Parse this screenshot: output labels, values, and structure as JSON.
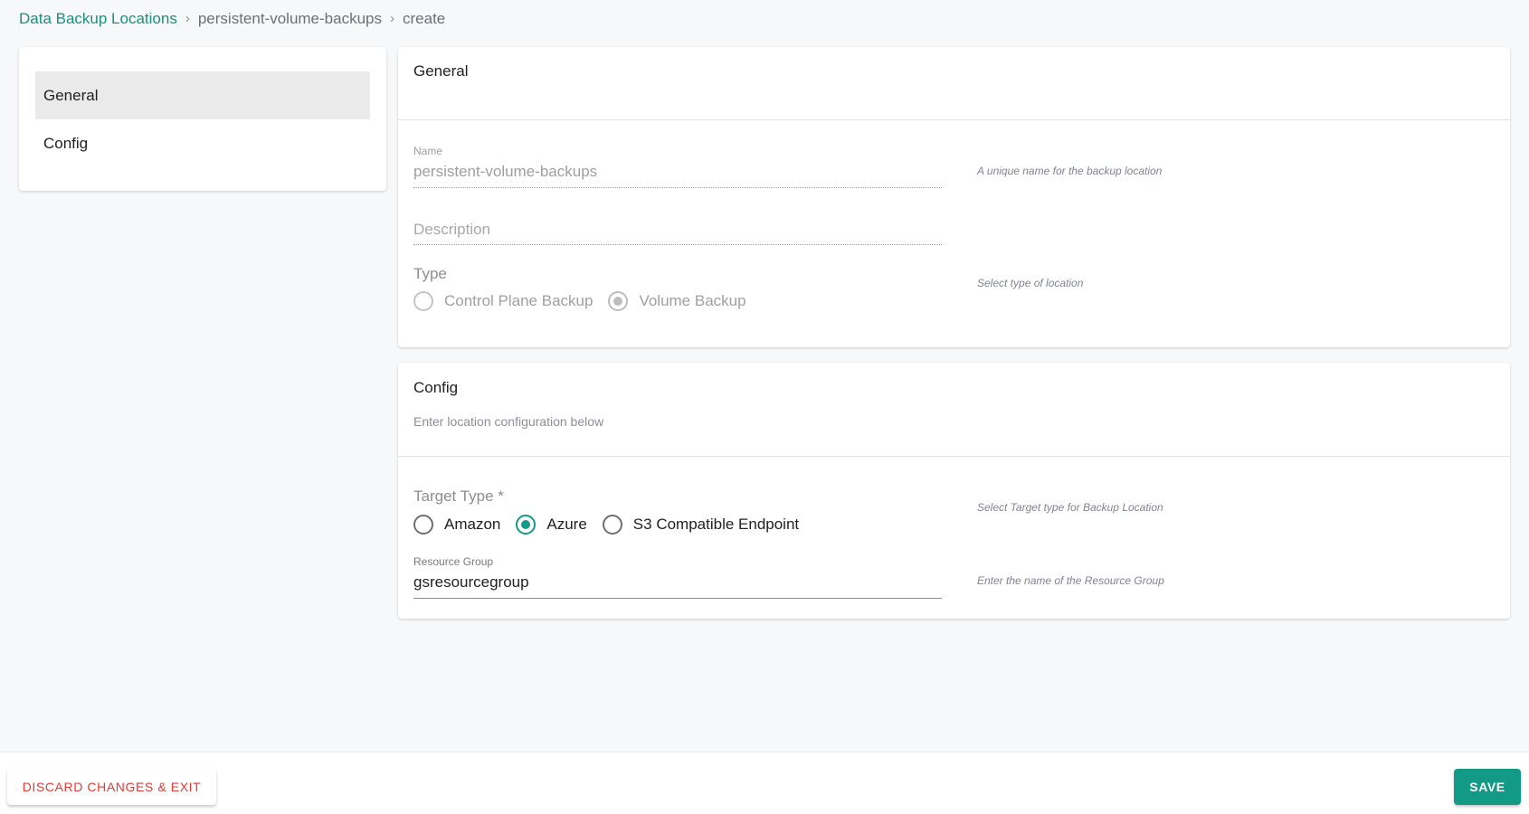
{
  "breadcrumb": {
    "items": [
      {
        "label": "Data Backup Locations",
        "link": true
      },
      {
        "label": "persistent-volume-backups",
        "link": false
      },
      {
        "label": "create",
        "link": false
      }
    ],
    "separator": "›"
  },
  "sidebar": {
    "items": [
      {
        "label": "General",
        "active": true
      },
      {
        "label": "Config",
        "active": false
      }
    ]
  },
  "general": {
    "title": "General",
    "name": {
      "label": "Name",
      "value": "persistent-volume-backups",
      "helper": "A unique name for the backup location",
      "disabled": true
    },
    "description": {
      "placeholder": "Description",
      "value": ""
    },
    "type": {
      "label": "Type",
      "helper": "Select type of location",
      "options": [
        {
          "label": "Control Plane Backup",
          "checked": false
        },
        {
          "label": "Volume Backup",
          "checked": true
        }
      ],
      "disabled": true
    }
  },
  "config": {
    "title": "Config",
    "subtitle": "Enter location configuration below",
    "target_type": {
      "label": "Target Type *",
      "helper": "Select Target type for Backup Location",
      "options": [
        {
          "label": "Amazon",
          "checked": false
        },
        {
          "label": "Azure",
          "checked": true
        },
        {
          "label": "S3 Compatible Endpoint",
          "checked": false
        }
      ]
    },
    "resource_group": {
      "label": "Resource Group",
      "value": "gsresourcegroup",
      "helper": "Enter the name of the Resource Group"
    }
  },
  "footer": {
    "discard_label": "DISCARD CHANGES & EXIT",
    "save_label": "SAVE"
  },
  "colors": {
    "accent": "#139a86",
    "link": "#1a8f7f",
    "danger": "#e53935",
    "background": "#f7f8fa"
  }
}
